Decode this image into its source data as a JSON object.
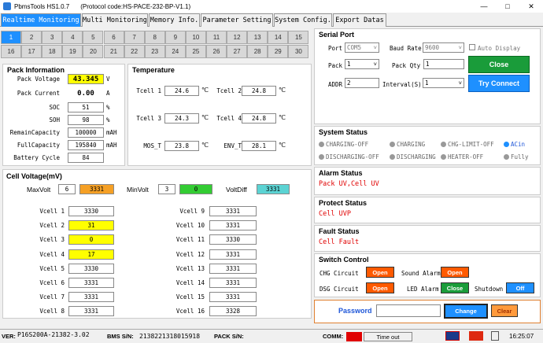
{
  "app": {
    "title": "PbmsTools HS1.0.7",
    "protocol": "(Protocol code:HS-PACE-232-BP-V1.1)"
  },
  "tabs": [
    "Realtime Monitoring",
    "Multi Monitoring",
    "Memory Info.",
    "Parameter Setting",
    "System Config.",
    "Export Datas"
  ],
  "cells_row1": [
    "1",
    "2",
    "3",
    "4",
    "5",
    "6",
    "7",
    "8",
    "9",
    "10",
    "11",
    "12",
    "13",
    "14",
    "15"
  ],
  "cells_row2": [
    "16",
    "17",
    "18",
    "19",
    "20",
    "21",
    "22",
    "23",
    "24",
    "25",
    "26",
    "27",
    "28",
    "29",
    "30"
  ],
  "pack": {
    "title": "Pack Information",
    "rows": [
      {
        "label": "Pack Voltage",
        "value": "43.345",
        "unit": "V"
      },
      {
        "label": "Pack Current",
        "value": "0.00",
        "unit": "A"
      },
      {
        "label": "SOC",
        "value": "51",
        "unit": "%"
      },
      {
        "label": "SOH",
        "value": "98",
        "unit": "%"
      },
      {
        "label": "RemainCapacity",
        "value": "100000",
        "unit": "mAH"
      },
      {
        "label": "FullCapacity",
        "value": "195840",
        "unit": "mAH"
      },
      {
        "label": "Battery Cycle",
        "value": "84",
        "unit": ""
      }
    ]
  },
  "temp": {
    "title": "Temperature",
    "unit": "℃",
    "items": [
      {
        "label": "Tcell 1",
        "value": "24.6"
      },
      {
        "label": "Tcell 2",
        "value": "24.8"
      },
      {
        "label": "Tcell 3",
        "value": "24.3"
      },
      {
        "label": "Tcell 4",
        "value": "24.8"
      },
      {
        "label": "MOS_T",
        "value": "23.8"
      },
      {
        "label": "ENV_T",
        "value": "28.1"
      }
    ]
  },
  "serial": {
    "title": "Serial Port",
    "port_label": "Port",
    "port_value": "COM5",
    "baud_label": "Baud Rate",
    "baud_value": "9600",
    "auto_display": "Auto Display",
    "pack_label": "Pack",
    "pack_value": "1",
    "qty_label": "Pack Qty",
    "qty_value": "1",
    "close": "Close",
    "addr_label": "ADDR",
    "addr_value": "2",
    "interval_label": "Interval(S)",
    "interval_value": "1",
    "try_connect": "Try Connect"
  },
  "system": {
    "title": "System Status",
    "items": [
      "CHARGING-OFF",
      "CHARGING",
      "CHG-LIMIT-OFF",
      "ACin",
      "DISCHARGING-OFF",
      "DISCHARGING",
      "HEATER-OFF",
      "Fully"
    ]
  },
  "alarm": {
    "title": "Alarm Status",
    "text": "Pack UV,Cell UV"
  },
  "protect": {
    "title": "Protect Status",
    "text": "Cell UVP"
  },
  "fault": {
    "title": "Fault Status",
    "text": "Cell Fault"
  },
  "switch": {
    "title": "Switch Control",
    "chg_label": "CHG Circuit",
    "chg_btn": "Open",
    "sound_label": "Sound Alarm",
    "sound_btn": "Open",
    "dsg_label": "DSG Circuit",
    "dsg_btn": "Open",
    "led_label": "LED Alarm",
    "led_btn": "Close",
    "shutdown_label": "Shutdown",
    "shutdown_btn": "Off"
  },
  "password": {
    "label": "Password",
    "change": "Change",
    "clear": "Clear"
  },
  "cv": {
    "title": "Cell Voltage(mV)",
    "maxvolt_label": "MaxVolt",
    "max_cell": "6",
    "max_value": "3331",
    "minvolt_label": "MinVolt",
    "min_cell": "3",
    "min_value": "0",
    "diff_label": "VoltDiff",
    "diff_value": "3331",
    "left": [
      {
        "label": "Vcell 1",
        "value": "3330"
      },
      {
        "label": "Vcell 2",
        "value": "31"
      },
      {
        "label": "Vcell 3",
        "value": "0"
      },
      {
        "label": "Vcell 4",
        "value": "17"
      },
      {
        "label": "Vcell 5",
        "value": "3330"
      },
      {
        "label": "Vcell 6",
        "value": "3331"
      },
      {
        "label": "Vcell 7",
        "value": "3331"
      },
      {
        "label": "Vcell 8",
        "value": "3331"
      }
    ],
    "right": [
      {
        "label": "Vcell 9",
        "value": "3331"
      },
      {
        "label": "Vcell 10",
        "value": "3331"
      },
      {
        "label": "Vcell 11",
        "value": "3330"
      },
      {
        "label": "Vcell 12",
        "value": "3331"
      },
      {
        "label": "Vcell 13",
        "value": "3331"
      },
      {
        "label": "Vcell 14",
        "value": "3331"
      },
      {
        "label": "Vcell 15",
        "value": "3331"
      },
      {
        "label": "Vcell 16",
        "value": "3328"
      }
    ]
  },
  "statusbar": {
    "ver_label": "VER:",
    "ver_value": "P16S200A-21382-3.02",
    "bms_label": "BMS S/N:",
    "bms_value": "2138221318015918",
    "pack_label": "PACK S/N:",
    "comm_label": "COMM:",
    "comm_value": "Time out",
    "time": "16:25:07"
  },
  "colors": {
    "blue": "#1e90ff",
    "green": "#1a9c3a",
    "orange": "#ff6a00",
    "yellow": "#ffff00",
    "cyan": "#5bd3d3"
  }
}
